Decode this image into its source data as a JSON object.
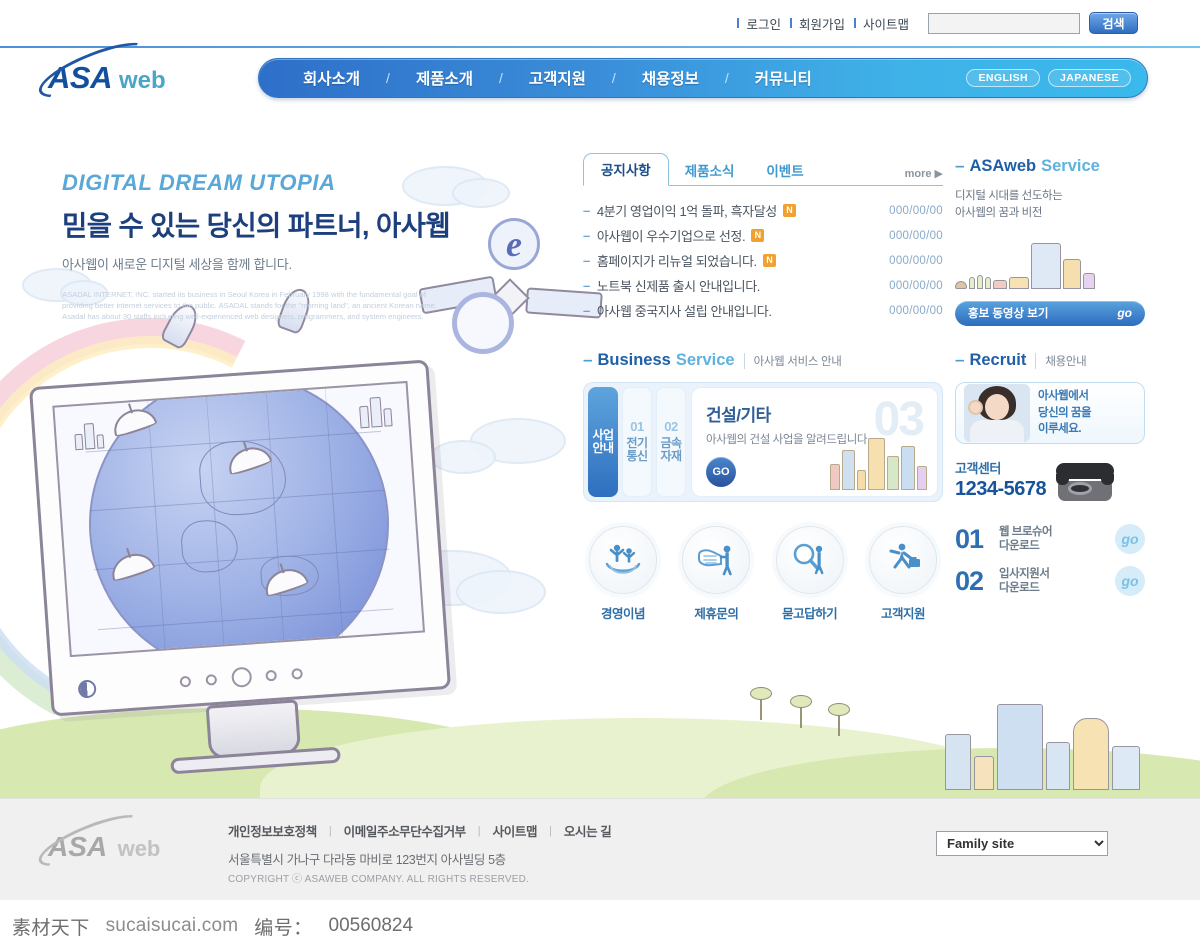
{
  "utility": {
    "links": [
      {
        "label": "로그인"
      },
      {
        "label": "회원가입"
      },
      {
        "label": "사이트맵"
      }
    ],
    "search_value": "",
    "search_placeholder": "",
    "search_button": "검색"
  },
  "brand": {
    "logo_main": "ASA",
    "logo_sub": "web",
    "accent_blue": "#12509e",
    "accent_cyan": "#4aa5c9"
  },
  "nav": {
    "items": [
      {
        "label": "회사소개"
      },
      {
        "label": "제품소개"
      },
      {
        "label": "고객지원"
      },
      {
        "label": "채용정보"
      },
      {
        "label": "커뮤니티"
      }
    ],
    "separator": "/",
    "languages": [
      {
        "label": "ENGLISH"
      },
      {
        "label": "JAPANESE"
      }
    ]
  },
  "hero": {
    "eng_title": "DIGITAL DREAM UTOPIA",
    "kor_title": "믿을 수 있는 당신의 파트너, 아사웹",
    "kor_sub": "아사웹이 새로운 디지털 세상을 함께 합니다.",
    "fine_print": "ASADAL INTERNET, INC. started its business in Seoul Korea in February 1998 with the fundamental goal of providing better internet services to the public. ASADAL stands for the \"morning land\", an ancient Korean name. Asadal has about 30 staffs including well-experienced web designers, programmers, and system engineers.",
    "satellite_logo": "e"
  },
  "notice": {
    "tabs": [
      {
        "label": "공지사항",
        "active": true
      },
      {
        "label": "제품소식",
        "active": false
      },
      {
        "label": "이벤트",
        "active": false
      }
    ],
    "more_label": "more",
    "more_arrow": "▶",
    "dash": "–",
    "badge_label": "N",
    "items": [
      {
        "title": "4분기 영업이익 1억 돌파, 흑자달성",
        "new": true,
        "date": "000/00/00"
      },
      {
        "title": "아사웹이 우수기업으로 선정.",
        "new": true,
        "date": "000/00/00"
      },
      {
        "title": "홈페이지가 리뉴얼 되었습니다.",
        "new": true,
        "date": "000/00/00"
      },
      {
        "title": "노트북 신제품 출시 안내입니다.",
        "new": false,
        "date": "000/00/00"
      },
      {
        "title": "아사웹 중국지사 설립 안내입니다.",
        "new": false,
        "date": "000/00/00"
      }
    ]
  },
  "business": {
    "heading_a": "Business",
    "heading_b": "Service",
    "heading_sub": "아사웹 서비스 안내",
    "tabs": [
      {
        "num": "",
        "label": "사업안내",
        "active": true
      },
      {
        "num": "01",
        "label": "전기통신",
        "active": false
      },
      {
        "num": "02",
        "label": "금속자재",
        "active": false
      }
    ],
    "panel": {
      "watermark": "03",
      "title": "건설/기타",
      "desc": "아사웹의 건설 사업을 알려드립니다.",
      "go_label": "GO"
    }
  },
  "quick_links": [
    {
      "label": "경영이념",
      "icon": "people-on-hands-icon"
    },
    {
      "label": "제휴문의",
      "icon": "handshake-icon"
    },
    {
      "label": "묻고답하기",
      "icon": "magnifier-person-icon"
    },
    {
      "label": "고객지원",
      "icon": "running-person-briefcase-icon"
    }
  ],
  "asaweb_service": {
    "heading_a": "ASAweb",
    "heading_b": "Service",
    "text_line1": "디지털 시대를 선도하는",
    "text_line2": "아사웹의 꿈과 비전",
    "button_label": "홍보 동영상 보기",
    "button_go": "go"
  },
  "recruit": {
    "heading": "Recruit",
    "heading_sub": "채용안내",
    "card_line1": "아사웹에서",
    "card_line2": "당신의 꿈을",
    "card_line3": "이루세요.",
    "cs_label": "고객센터",
    "cs_number": "1234-5678"
  },
  "downloads": [
    {
      "num": "01",
      "line1": "웹 브로슈어",
      "line2": "다운로드",
      "go": "go"
    },
    {
      "num": "02",
      "line1": "입사지원서",
      "line2": "다운로드",
      "go": "go"
    }
  ],
  "footer": {
    "logo_main": "ASA",
    "logo_sub": "web",
    "links": [
      {
        "label": "개인정보보호정책"
      },
      {
        "label": "이메일주소무단수집거부"
      },
      {
        "label": "사이트맵"
      },
      {
        "label": "오시는 길"
      }
    ],
    "separator": "|",
    "address": "서울특별시 가나구 다라동 마비로 123번지 아사빌딩 5층",
    "copyright": "COPYRIGHT ⓒ ASAWEB COMPANY. ALL RIGHTS RESERVED.",
    "family_site_label": "Family site"
  },
  "watermark": {
    "brand": "素材天下",
    "site": "sucaisucai.com",
    "id_label": "编号：",
    "id_value": "00560824"
  }
}
